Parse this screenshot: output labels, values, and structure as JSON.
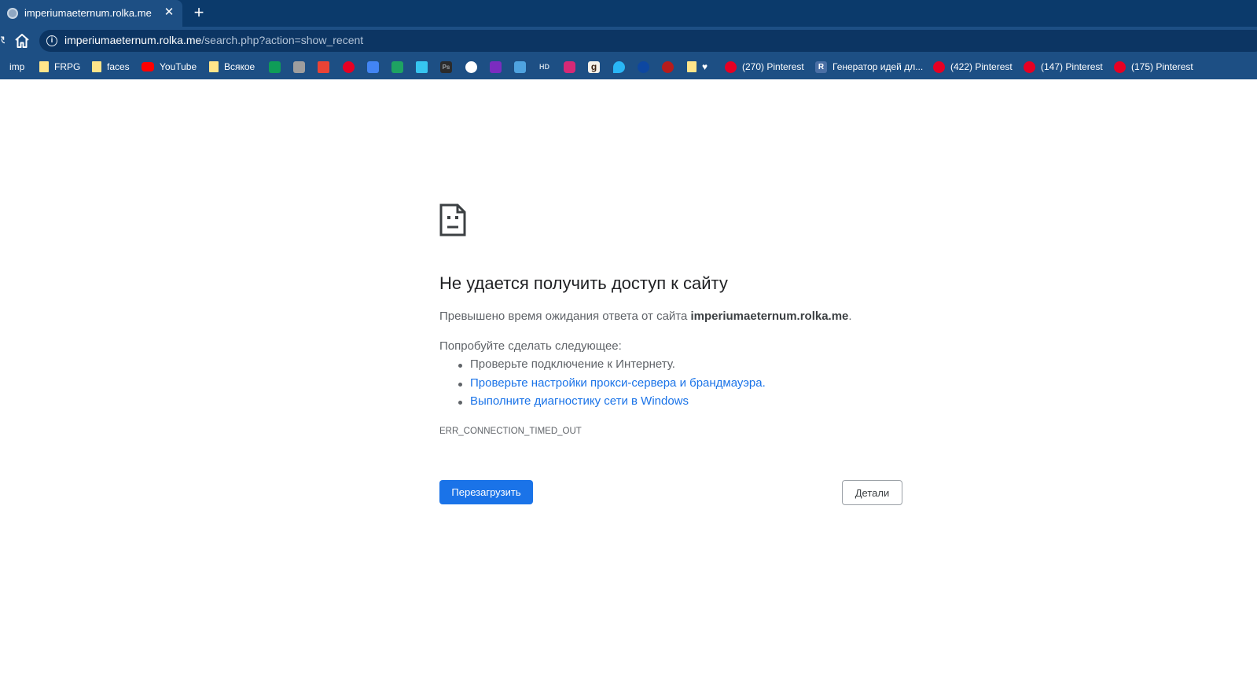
{
  "tab": {
    "title": "imperiumaeternum.rolka.me",
    "close_glyph": "✕",
    "new_tab_glyph": "+"
  },
  "omnibox": {
    "host": "imperiumaeternum.rolka.me",
    "path": "/search.php?action=show_recent",
    "info_glyph": "i"
  },
  "bookmarks": {
    "imp": "imp",
    "frpg": "FRPG",
    "faces": "faces",
    "youtube": "YouTube",
    "vsyakoe": "Всякое",
    "pinterest_270": "(270) Pinterest",
    "generator": "Генератор идей дл...",
    "pinterest_422": "(422) Pinterest",
    "pinterest_147": "(147) Pinterest",
    "pinterest_175": "(175) Pinterest",
    "ps_glyph": "Ps",
    "hd_glyph": "HD",
    "g_glyph": "g",
    "r_glyph": "R",
    "heart_glyph": "♥"
  },
  "error": {
    "title": "Не удается получить доступ к сайту",
    "desc_prefix": "Превышено время ожидания ответа от сайта ",
    "desc_host": "imperiumaeternum.rolka.me",
    "desc_suffix": ".",
    "try_title": "Попробуйте сделать следующее:",
    "suggestions": [
      "Проверьте подключение к Интернету.",
      "Проверьте настройки прокси-сервера и брандмауэра.",
      "Выполните диагностику сети в Windows"
    ],
    "code": "ERR_CONNECTION_TIMED_OUT",
    "reload_label": "Перезагрузить",
    "details_label": "Детали"
  },
  "colors": {
    "accent": "#1a73e8",
    "chrome_dark": "#0b3a6b",
    "chrome": "#1d4f84"
  }
}
